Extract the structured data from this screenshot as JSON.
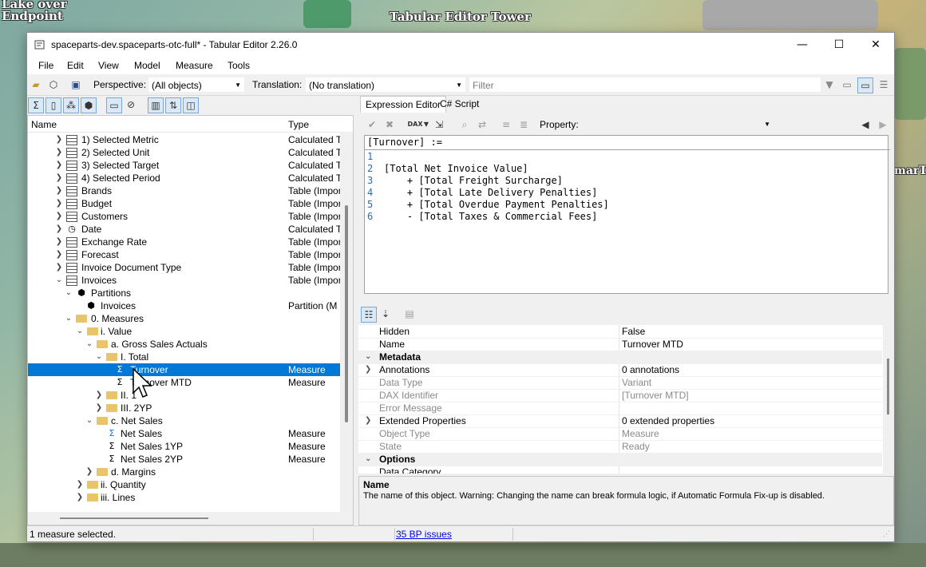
{
  "background": {
    "label_left": "Lake over\nEndpoint",
    "label_center": "Tabular Editor Tower",
    "label_right": "marT"
  },
  "window": {
    "title": "spaceparts-dev.spaceparts-otc-full* - Tabular Editor 2.26.0",
    "minimize": "—",
    "maximize": "☐",
    "close": "✕"
  },
  "menu": [
    "File",
    "Edit",
    "View",
    "Model",
    "Measure",
    "Tools"
  ],
  "toolbar": {
    "perspective_label": "Perspective:",
    "perspective_value": "(All objects)",
    "translation_label": "Translation:",
    "translation_value": "(No translation)",
    "filter_placeholder": "Filter"
  },
  "tree": {
    "col_name": "Name",
    "col_type": "Type",
    "rows": [
      {
        "label": "1) Selected Metric",
        "type": "Calculated Ta"
      },
      {
        "label": "2) Selected Unit",
        "type": "Calculated Ta"
      },
      {
        "label": "3) Selected Target",
        "type": "Calculated Ta"
      },
      {
        "label": "4) Selected Period",
        "type": "Calculated Ta"
      },
      {
        "label": "Brands",
        "type": "Table (Import)"
      },
      {
        "label": "Budget",
        "type": "Table (Import)"
      },
      {
        "label": "Customers",
        "type": "Table (Import)"
      },
      {
        "label": "Date",
        "type": "Calculated Ta"
      },
      {
        "label": "Exchange Rate",
        "type": "Table (Import)"
      },
      {
        "label": "Forecast",
        "type": "Table (Import)"
      },
      {
        "label": "Invoice Document Type",
        "type": "Table (Import)"
      },
      {
        "label": "Invoices",
        "type": "Table (Import)"
      },
      {
        "label": "Partitions",
        "type": ""
      },
      {
        "label": "Invoices",
        "type": "Partition (M - I"
      },
      {
        "label": "0. Measures",
        "type": ""
      },
      {
        "label": "i. Value",
        "type": ""
      },
      {
        "label": "a. Gross Sales Actuals",
        "type": ""
      },
      {
        "label": "I. Total",
        "type": ""
      },
      {
        "label": "Turnover",
        "type": "Measure"
      },
      {
        "label": "Turnover MTD",
        "type": "Measure"
      },
      {
        "label": "II. 1",
        "type": ""
      },
      {
        "label": "III. 2YP",
        "type": ""
      },
      {
        "label": "c. Net Sales",
        "type": ""
      },
      {
        "label": "Net Sales",
        "type": "Measure"
      },
      {
        "label": "Net Sales 1YP",
        "type": "Measure"
      },
      {
        "label": "Net Sales 2YP",
        "type": "Measure"
      },
      {
        "label": "d. Margins",
        "type": ""
      },
      {
        "label": "ii. Quantity",
        "type": ""
      },
      {
        "label": "iii. Lines",
        "type": ""
      }
    ]
  },
  "editor": {
    "tabs": [
      "Expression Editor",
      "C# Script"
    ],
    "property_label": "Property:",
    "header": "[Turnover] :=",
    "lines": [
      {
        "n": "1",
        "text": ""
      },
      {
        "n": "2",
        "text": "[Total Net Invoice Value]"
      },
      {
        "n": "3",
        "text": "    + [Total Freight Surcharge]"
      },
      {
        "n": "4",
        "text": "    + [Total Late Delivery Penalties]"
      },
      {
        "n": "5",
        "text": "    + [Total Overdue Payment Penalties]"
      },
      {
        "n": "6",
        "text": "    - [Total Taxes & Commercial Fees]"
      }
    ]
  },
  "properties": {
    "rows": [
      {
        "name": "Hidden",
        "value": "False",
        "kind": "prop"
      },
      {
        "name": "Name",
        "value": "Turnover MTD",
        "kind": "prop"
      },
      {
        "name": "Metadata",
        "value": "",
        "kind": "cat"
      },
      {
        "name": "Annotations",
        "value": "0 annotations",
        "kind": "exp"
      },
      {
        "name": "Data Type",
        "value": "Variant",
        "kind": "dim"
      },
      {
        "name": "DAX Identifier",
        "value": "[Turnover MTD]",
        "kind": "dim"
      },
      {
        "name": "Error Message",
        "value": "",
        "kind": "dim"
      },
      {
        "name": "Extended Properties",
        "value": "0 extended properties",
        "kind": "exp"
      },
      {
        "name": "Object Type",
        "value": "Measure",
        "kind": "dim"
      },
      {
        "name": "State",
        "value": "Ready",
        "kind": "dim"
      },
      {
        "name": "Options",
        "value": "",
        "kind": "cat"
      },
      {
        "name": "Data Category",
        "value": "",
        "kind": "prop"
      }
    ],
    "desc_title": "Name",
    "desc_text": "The name of this object. Warning: Changing the name can break formula logic, if Automatic Formula Fix-up is disabled."
  },
  "status": {
    "left": "1 measure selected.",
    "issues": "35 BP issues"
  },
  "colors": {
    "selection": "#0078d7",
    "line_number": "#1e6ec8"
  }
}
